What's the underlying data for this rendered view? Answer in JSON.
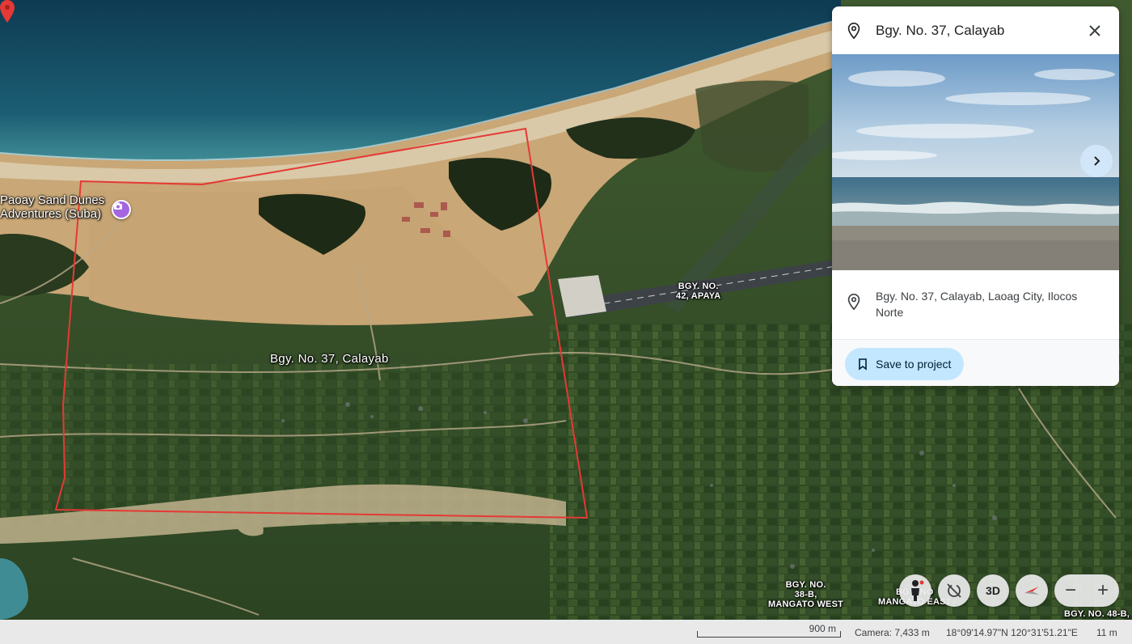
{
  "map": {
    "poi_label": "Paoay Sand Dunes\nAdventures (Suba)",
    "place_label": "Bgy. No. 37, Calayab",
    "region_labels": [
      {
        "id": "apaya",
        "text": "BGY. NO.\n42, APAYA"
      },
      {
        "id": "mangato-west",
        "text": "BGY. NO.\n38-B,\nMANGATO WEST"
      },
      {
        "id": "mangato-east",
        "text": "BGY. NO\nMANGATO EAST"
      },
      {
        "id": "bgy-48b",
        "text": "BGY. NO. 48-B,"
      }
    ],
    "boundary_color": "#e53935"
  },
  "panel": {
    "title": "Bgy. No. 37, Calayab",
    "address": "Bgy. No. 37, Calayab, Laoag City, Ilocos Norte",
    "save_label": "Save to project",
    "icons": {
      "location": "location-pin-icon",
      "close": "close-icon",
      "next": "chevron-right-icon",
      "bookmark": "bookmark-icon"
    }
  },
  "controls": {
    "street_view": "pegman-icon",
    "reset_view": "rotate-reset-icon",
    "mode_label": "3D",
    "compass": "compass-icon",
    "zoom_out": "−",
    "zoom_in": "+"
  },
  "status": {
    "scale_label": "900 m",
    "camera": "Camera: 7,433 m",
    "coordinates": "18°09'14.97\"N 120°31'51.21\"E",
    "elevation": "11 m"
  }
}
